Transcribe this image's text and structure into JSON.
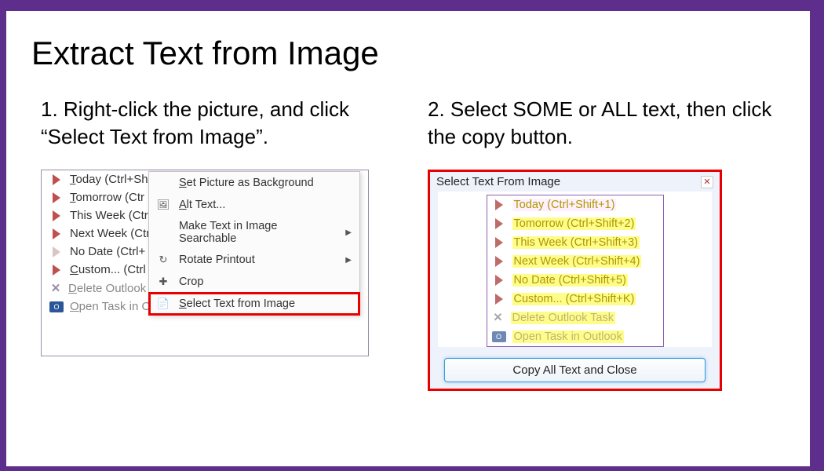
{
  "title": "Extract Text from Image",
  "step1": "1. Right-click the picture, and click “Select Text from Image”.",
  "step2": "2. Select SOME or ALL text, then click the copy button.",
  "left": {
    "tasks": [
      {
        "icon": "flag",
        "label_u": "T",
        "label_rest": "oday  (Ctrl+Sh"
      },
      {
        "icon": "flag",
        "label_u": "T",
        "label_rest": "omorrow  (Ctr"
      },
      {
        "icon": "flag",
        "label_u": "",
        "label_rest": "This Week  (Ctr"
      },
      {
        "icon": "flag",
        "label_u": "",
        "label_rest": "Next Week  (Ctr"
      },
      {
        "icon": "flagc",
        "label_u": "",
        "label_rest": "No Date  (Ctrl+"
      },
      {
        "icon": "flag",
        "label_u": "C",
        "label_rest": "ustom...  (Ctrl"
      },
      {
        "icon": "x",
        "label_u": "D",
        "label_rest": "elete Outlook Task",
        "disabled": true
      },
      {
        "icon": "ot",
        "label_u": "O",
        "label_rest": "pen Task in Outlook",
        "disabled": true
      }
    ],
    "context_menu": [
      {
        "icon": "",
        "label_u": "S",
        "label_rest": "et Picture as Background"
      },
      {
        "icon": "alt",
        "label_u": "A",
        "label_rest": "lt Text..."
      },
      {
        "icon": "",
        "label_u": "",
        "label_rest": "Make Text in Image Searchable",
        "sub": true
      },
      {
        "icon": "rot",
        "label_u": "",
        "label_rest": "Rotate Printout",
        "sub": true
      },
      {
        "icon": "crop",
        "label_u": "",
        "label_rest": "Crop"
      },
      {
        "icon": "sel",
        "label_u": "S",
        "label_rest": "elect Text from Image",
        "hl": true
      }
    ]
  },
  "right": {
    "dialog_title": "Select Text From Image",
    "items": [
      {
        "icon": "flag",
        "label": "Today  (Ctrl+Shift+1)",
        "sel": true
      },
      {
        "icon": "flag",
        "label": "Tomorrow  (Ctrl+Shift+2)"
      },
      {
        "icon": "flag",
        "label": "This Week  (Ctrl+Shift+3)"
      },
      {
        "icon": "flag",
        "label": "Next Week  (Ctrl+Shift+4)"
      },
      {
        "icon": "flagc",
        "label": "No Date  (Ctrl+Shift+5)"
      },
      {
        "icon": "flag",
        "label": "Custom...  (Ctrl+Shift+K)"
      },
      {
        "icon": "x",
        "label": "Delete Outlook Task",
        "dim": true
      },
      {
        "icon": "ot",
        "label": "Open Task in Outlook",
        "dim": true
      }
    ],
    "button": "Copy All Text and Close"
  }
}
